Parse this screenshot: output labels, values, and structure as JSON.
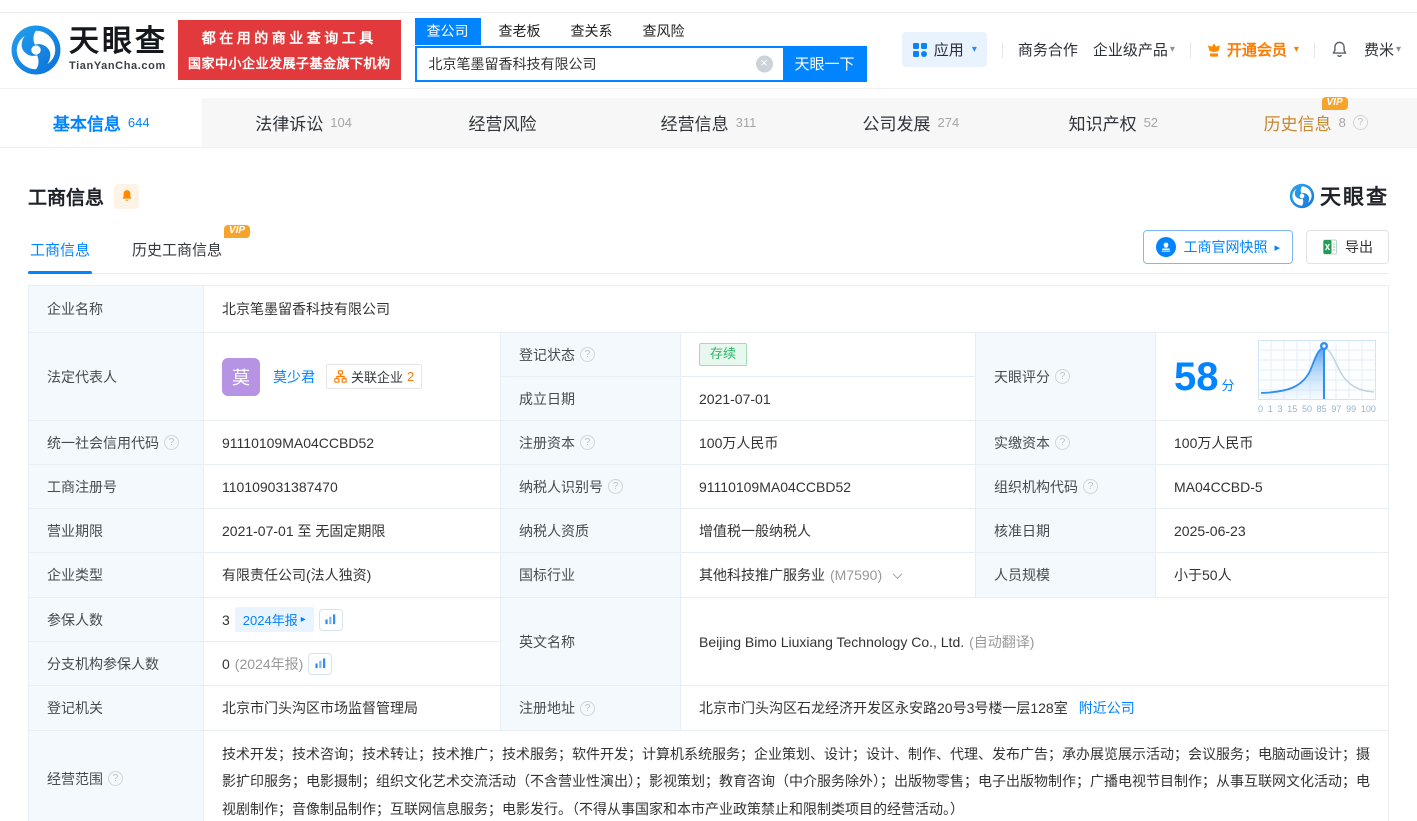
{
  "header": {
    "brand": {
      "name": "天眼查",
      "domain": "TianYanCha.com"
    },
    "promo": {
      "line1": "都在用的商业查询工具",
      "line2": "国家中小企业发展子基金旗下机构"
    },
    "search": {
      "tabs": [
        {
          "label": "查公司"
        },
        {
          "label": "查老板"
        },
        {
          "label": "查关系"
        },
        {
          "label": "查风险"
        }
      ],
      "value": "北京笔墨留香科技有限公司",
      "submit": "天眼一下"
    },
    "nav": {
      "apps": "应用",
      "cooperation": "商务合作",
      "enterprise": "企业级产品",
      "vip": "开通会员",
      "user": "费米"
    }
  },
  "nav_tabs": [
    {
      "label": "基本信息",
      "count": "644"
    },
    {
      "label": "法律诉讼",
      "count": "104"
    },
    {
      "label": "经营风险",
      "count": ""
    },
    {
      "label": "经营信息",
      "count": "311"
    },
    {
      "label": "公司发展",
      "count": "274"
    },
    {
      "label": "知识产权",
      "count": "52"
    },
    {
      "label": "历史信息",
      "count": "8",
      "vip": "VIP"
    }
  ],
  "section": {
    "title": "工商信息",
    "subtabs": [
      {
        "label": "工商信息"
      },
      {
        "label": "历史工商信息",
        "vip": "VIP"
      }
    ],
    "snapshot": "工商官网快照",
    "export": "导出",
    "watermark": "天眼查"
  },
  "info": {
    "company_name": {
      "label": "企业名称",
      "value": "北京笔墨留香科技有限公司"
    },
    "legal_rep": {
      "label": "法定代表人",
      "avatar": "莫",
      "name": "莫少君",
      "tag": "关联企业",
      "tag_count": "2"
    },
    "reg_status": {
      "label": "登记状态",
      "value": "存续"
    },
    "establish_date": {
      "label": "成立日期",
      "value": "2021-07-01"
    },
    "score": {
      "label": "天眼评分",
      "value": "58",
      "unit": "分",
      "axis": [
        "0",
        "1",
        "3",
        "15",
        "50",
        "85",
        "97",
        "99",
        "100"
      ]
    },
    "credit_code": {
      "label": "统一社会信用代码",
      "value": "91110109MA04CCBD52"
    },
    "reg_capital": {
      "label": "注册资本",
      "value": "100万人民币"
    },
    "paid_capital": {
      "label": "实缴资本",
      "value": "100万人民币"
    },
    "reg_number": {
      "label": "工商注册号",
      "value": "110109031387470"
    },
    "taxpayer_id": {
      "label": "纳税人识别号",
      "value": "91110109MA04CCBD52"
    },
    "org_code": {
      "label": "组织机构代码",
      "value": "MA04CCBD-5"
    },
    "business_term": {
      "label": "营业期限",
      "value": "2021-07-01 至 无固定期限"
    },
    "taxpayer_quality": {
      "label": "纳税人资质",
      "value": "增值税一般纳税人"
    },
    "approval_date": {
      "label": "核准日期",
      "value": "2025-06-23"
    },
    "company_type": {
      "label": "企业类型",
      "value": "有限责任公司(法人独资)"
    },
    "industry": {
      "label": "国标行业",
      "value": "其他科技推广服务业",
      "code": "(M7590)"
    },
    "staff_size": {
      "label": "人员规模",
      "value": "小于50人"
    },
    "insured_count": {
      "label": "参保人数",
      "value": "3",
      "report": "2024年报"
    },
    "branch_insured": {
      "label": "分支机构参保人数",
      "value": "0",
      "report": "(2024年报)"
    },
    "english_name": {
      "label": "英文名称",
      "value": "Beijing Bimo Liuxiang Technology Co., Ltd.",
      "note": "(自动翻译)"
    },
    "reg_authority": {
      "label": "登记机关",
      "value": "北京市门头沟区市场监督管理局"
    },
    "reg_address": {
      "label": "注册地址",
      "value": "北京市门头沟区石龙经济开发区永安路20号3号楼一层128室",
      "link": "附近公司"
    },
    "business_scope": {
      "label": "经营范围",
      "value": "技术开发；技术咨询；技术转让；技术推广；技术服务；软件开发；计算机系统服务；企业策划、设计；设计、制作、代理、发布广告；承办展览展示活动；会议服务；电脑动画设计；摄影扩印服务；电影摄制；组织文化艺术交流活动（不含营业性演出）；影视策划；教育咨询（中介服务除外）；出版物零售；电子出版物制作；广播电视节目制作；从事互联网文化活动；电视剧制作；音像制品制作；互联网信息服务；电影发行。（不得从事国家和本市产业政策禁止和限制类项目的经营活动。）"
    }
  },
  "colors": {
    "primary": "#0084ff",
    "orange": "#ff7a00",
    "red": "#e23a3c",
    "green": "#2bb56a"
  }
}
